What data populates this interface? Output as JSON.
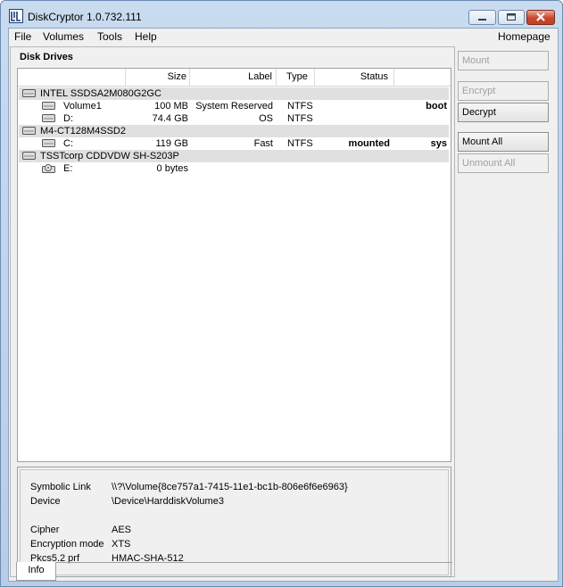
{
  "window": {
    "title": "DiskCryptor 1.0.732.111"
  },
  "menu": {
    "items": [
      "File",
      "Volumes",
      "Tools",
      "Help"
    ],
    "homepage": "Homepage"
  },
  "panel": {
    "title": "Disk Drives"
  },
  "columns": {
    "size": "Size",
    "label": "Label",
    "type": "Type",
    "status": "Status"
  },
  "rows": [
    {
      "kind": "disk",
      "name": "INTEL SSDSA2M080G2GC",
      "size": "",
      "label": "",
      "type": "",
      "status": "",
      "flag": ""
    },
    {
      "kind": "volume",
      "name": "Volume1",
      "size": "100 MB",
      "label": "System Reserved",
      "type": "NTFS",
      "status": "",
      "flag": "boot"
    },
    {
      "kind": "volume",
      "name": "D:",
      "size": "74.4 GB",
      "label": "OS",
      "type": "NTFS",
      "status": "",
      "flag": ""
    },
    {
      "kind": "disk",
      "name": "M4-CT128M4SSD2",
      "size": "",
      "label": "",
      "type": "",
      "status": "",
      "flag": ""
    },
    {
      "kind": "volume-selected",
      "name": "C:",
      "size": "119 GB",
      "label": "Fast",
      "type": "NTFS",
      "status": "mounted",
      "flag": "sys"
    },
    {
      "kind": "disk",
      "name": "TSSTcorp CDDVDW SH-S203P",
      "size": "",
      "label": "",
      "type": "",
      "status": "",
      "flag": ""
    },
    {
      "kind": "cdrom",
      "name": "E:",
      "size": "0 bytes",
      "label": "",
      "type": "",
      "status": "",
      "flag": ""
    }
  ],
  "info": {
    "symbolic_link_label": "Symbolic Link",
    "symbolic_link": "\\\\?\\Volume{8ce757a1-7415-11e1-bc1b-806e6f6e6963}",
    "device_label": "Device",
    "device": "\\Device\\HarddiskVolume3",
    "cipher_label": "Cipher",
    "cipher": "AES",
    "mode_label": "Encryption mode",
    "mode": "XTS",
    "prf_label": "Pkcs5.2 prf",
    "prf": "HMAC-SHA-512"
  },
  "tab": {
    "label": "Info"
  },
  "buttons": {
    "mount": "Mount",
    "encrypt": "Encrypt",
    "decrypt": "Decrypt",
    "mount_all": "Mount All",
    "unmount_all": "Unmount All"
  },
  "colors": {
    "disk_row": "#e0e0e0",
    "title_gradient": "#c9dbef"
  }
}
